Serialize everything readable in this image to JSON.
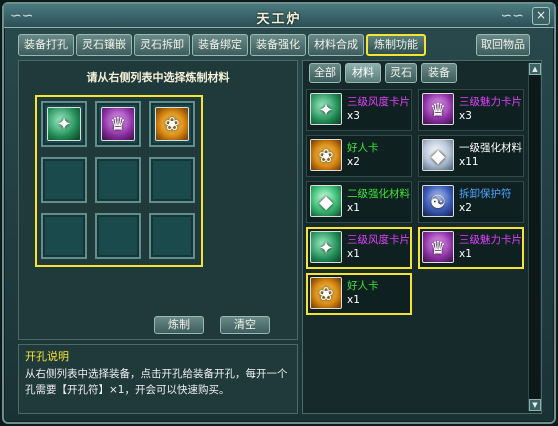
{
  "window": {
    "title": "天工炉",
    "close": "×",
    "deco_left": "∽∽",
    "deco_right": "∽∽"
  },
  "tabs": [
    "装备打孔",
    "灵石镶嵌",
    "灵石拆卸",
    "装备绑定",
    "装备强化",
    "材料合成",
    "炼制功能"
  ],
  "active_tab": "炼制功能",
  "retrieve_button": "取回物品",
  "left": {
    "hint": "请从右侧列表中选择炼制材料",
    "grid": [
      {
        "icon": "green-card-icon",
        "symbol": "✦"
      },
      {
        "icon": "pink-card-icon",
        "symbol": "♛"
      },
      {
        "icon": "gold-card-icon",
        "symbol": "❀"
      },
      null,
      null,
      null,
      null,
      null,
      null
    ],
    "forge_button": "炼制",
    "clear_button": "清空"
  },
  "description": {
    "title": "开孔说明",
    "body": "从右侧列表中选择装备，点击开孔给装备开孔，每开一个孔需要【开孔符】×1，开会可以快速购买。"
  },
  "right": {
    "tabs": [
      "全部",
      "材料",
      "灵石",
      "装备"
    ],
    "active_tab": "材料",
    "items": [
      {
        "name": "三级风度卡片",
        "count": "x3",
        "color": "#e040fb",
        "icon": "green-card-icon",
        "symbol": "✦",
        "selected": false
      },
      {
        "name": "三级魅力卡片",
        "count": "x3",
        "color": "#e040fb",
        "icon": "pink-card-icon",
        "symbol": "♛",
        "selected": false
      },
      {
        "name": "好人卡",
        "count": "x2",
        "color": "#39e639",
        "icon": "gold-card-icon",
        "symbol": "❀",
        "selected": false
      },
      {
        "name": "一级强化材料",
        "count": "x11",
        "color": "#ffffff",
        "icon": "silver-gem-icon",
        "symbol": "◆",
        "selected": false
      },
      {
        "name": "二级强化材料",
        "count": "x1",
        "color": "#39e639",
        "icon": "jade-gem-icon",
        "symbol": "◆",
        "selected": false
      },
      {
        "name": "拆卸保护符",
        "count": "x2",
        "color": "#4aa6ff",
        "icon": "blue-talisman-icon",
        "symbol": "☯",
        "selected": false
      },
      {
        "name": "三级风度卡片",
        "count": "x1",
        "color": "#e040fb",
        "icon": "green-card-icon",
        "symbol": "✦",
        "selected": true
      },
      {
        "name": "三级魅力卡片",
        "count": "x1",
        "color": "#e040fb",
        "icon": "pink-card-icon",
        "symbol": "♛",
        "selected": true
      },
      {
        "name": "好人卡",
        "count": "x1",
        "color": "#39e639",
        "icon": "gold-card-icon",
        "symbol": "❀",
        "selected": true
      }
    ],
    "scroll_up": "▲",
    "scroll_down": "▼"
  }
}
